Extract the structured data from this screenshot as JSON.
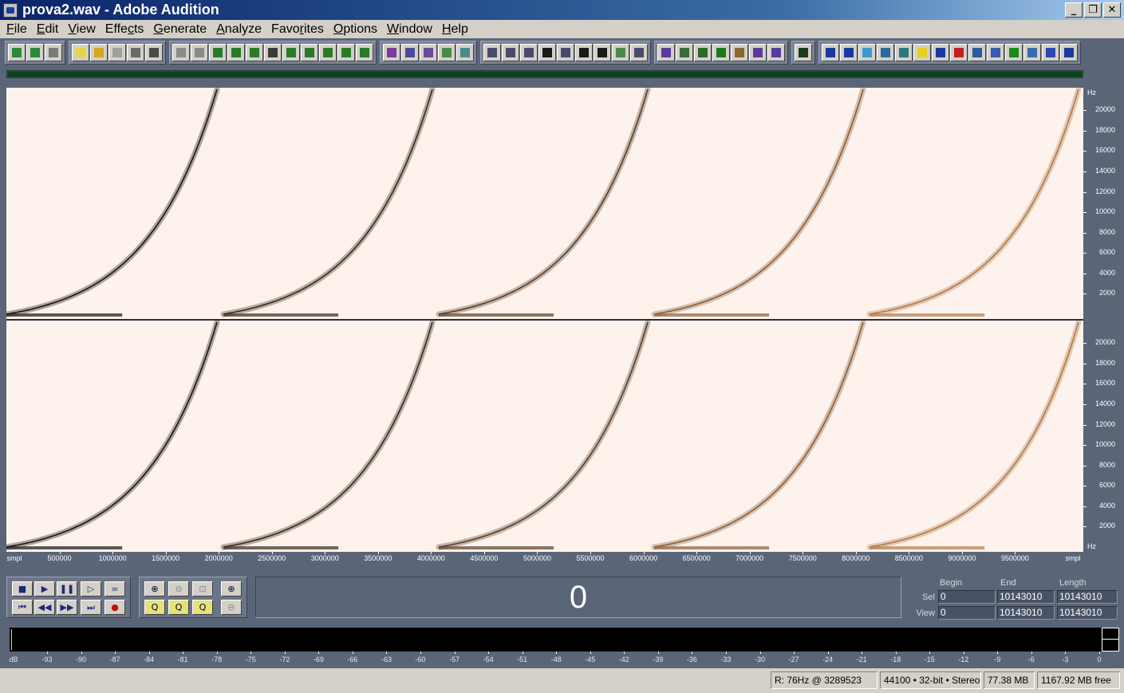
{
  "window": {
    "title": "prova2.wav - Adobe Audition",
    "icon": "audition-app-icon",
    "minimize_glyph": "_",
    "restore_glyph": "❐",
    "close_glyph": "✕"
  },
  "menu": [
    {
      "label": "File",
      "ul": "F",
      "rest": "ile"
    },
    {
      "label": "Edit",
      "ul": "E",
      "rest": "dit"
    },
    {
      "label": "View",
      "ul": "V",
      "rest": "iew"
    },
    {
      "label": "Effects",
      "pre": "Effe",
      "ul": "c",
      "rest": "ts"
    },
    {
      "label": "Generate",
      "ul": "G",
      "rest": "enerate"
    },
    {
      "label": "Analyze",
      "ul": "A",
      "rest": "nalyze"
    },
    {
      "label": "Favorites",
      "pre": "Favo",
      "ul": "r",
      "rest": "ites"
    },
    {
      "label": "Options",
      "ul": "O",
      "rest": "ptions"
    },
    {
      "label": "Window",
      "ul": "W",
      "rest": "indow"
    },
    {
      "label": "Help",
      "ul": "H",
      "rest": "elp"
    }
  ],
  "toolbar_groups": [
    {
      "icons": [
        "multitrack-view-icon",
        "edit-view-icon",
        "cd-view-icon"
      ],
      "colors": [
        "#2a8a3a",
        "#2a8a3a",
        "#7a7a7a"
      ]
    },
    {
      "icons": [
        "new-file-icon",
        "open-file-icon",
        "save-icon",
        "save-as-icon",
        "save-all-icon"
      ],
      "colors": [
        "#e6d44a",
        "#d4a820",
        "#a0a0a0",
        "#6a6a6a",
        "#4a4a4a"
      ]
    },
    {
      "icons": [
        "undo-icon",
        "redo-icon",
        "repeat-icon",
        "copy-to-new-icon",
        "copy-icon",
        "cut-icon",
        "paste-icon",
        "paste-new-icon",
        "mix-paste-icon",
        "trim-icon",
        "crop-icon"
      ],
      "colors": [
        "#8a8a8a",
        "#8a8a8a",
        "#2a7a2a",
        "#2a7a2a",
        "#2a7a2a",
        "#3a3a3a",
        "#2a7a2a",
        "#2a7a2a",
        "#2a7a2a",
        "#2a7a2a",
        "#2a7a2a"
      ]
    },
    {
      "icons": [
        "envelope-icon",
        "check-icon",
        "grid-purple-icon",
        "grid-green-icon",
        "grid-multi-icon"
      ],
      "colors": [
        "#7a3aa0",
        "#4a4aa0",
        "#6a4a9a",
        "#4a8a4a",
        "#4a8a8a"
      ]
    },
    {
      "icons": [
        "window-icon",
        "window2-icon",
        "window3-icon",
        "play-arrow-icon",
        "zoom-small-icon",
        "time-015-icon",
        "bbb-icon",
        "bars-icon",
        "list-icon"
      ],
      "colors": [
        "#4a4a6a",
        "#4a4a6a",
        "#4a4a6a",
        "#1a1a1a",
        "#4a4a6a",
        "#1a1a1a",
        "#1a1a1a",
        "#4a8a4a",
        "#4a4a6a"
      ]
    },
    {
      "icons": [
        "pencil-purple-icon",
        "noise-icon",
        "noise2-icon",
        "wave-green-icon",
        "brush-icon",
        "pencil-icon",
        "pencil2-icon"
      ],
      "colors": [
        "#5a3aa0",
        "#3a6a3a",
        "#2a6a2a",
        "#1a7a1a",
        "#8a6a2a",
        "#5a3aa0",
        "#5a3aa0"
      ]
    },
    {
      "icons": [
        "spectrum-meter-icon"
      ],
      "colors": [
        "#1a3a1a"
      ]
    },
    {
      "icons": [
        "ap-icon",
        "ap42-icon",
        "mg-icon",
        "vrd-icon",
        "close-x-icon",
        "yellow-icon",
        "tb-icon",
        "red-green-icon",
        "bars-blue-icon",
        "stripes-icon",
        "tree-icon",
        "itu-p56-icon",
        "sti-icon",
        "flag-icon"
      ],
      "colors": [
        "#1a3aa0",
        "#1a3aa0",
        "#3a9aca",
        "#2a6aa0",
        "#2a7a7a",
        "#e6d020",
        "#1a3aa0",
        "#c02020",
        "#2a5aa0",
        "#3a5ab0",
        "#1a8a1a",
        "#3a6ab0",
        "#2a4ab0",
        "#1a3aa0"
      ]
    }
  ],
  "spectral": {
    "channels": [
      "left",
      "right"
    ],
    "bg_color": "#fdf2ec",
    "sweep_count": 5,
    "sweep_colors": [
      "#1a1512",
      "#3a2a1e",
      "#5a3e2a",
      "#8a5e3a",
      "#b07a4a"
    ]
  },
  "hz_ruler": {
    "unit": "Hz",
    "labels": [
      "20000",
      "18000",
      "16000",
      "14000",
      "12000",
      "10000",
      "8000",
      "6000",
      "4000",
      "2000"
    ]
  },
  "time_ruler": {
    "unit": "smpl",
    "labels": [
      "500000",
      "1000000",
      "1500000",
      "2000000",
      "2500000",
      "3000000",
      "3500000",
      "4000000",
      "4500000",
      "5000000",
      "5500000",
      "6000000",
      "6500000",
      "7000000",
      "7500000",
      "8000000",
      "8500000",
      "9000000",
      "9500000"
    ]
  },
  "transport": {
    "stop": "■",
    "play": "▶",
    "pause": "❚❚",
    "play_to_end": "▷",
    "loop": "∞",
    "go_start": "⏮",
    "rewind": "◀◀",
    "forward": "▶▶",
    "go_end": "⏭",
    "record": "●"
  },
  "zoom": {
    "zoom_in_h": "⊕",
    "zoom_out_h": "⊖",
    "zoom_full": "⊡",
    "zoom_in_v": "⊕",
    "zoom_left": "Q",
    "zoom_right": "Q",
    "zoom_sel": "Q",
    "zoom_out_v": "⊖"
  },
  "time_display": {
    "value": "0"
  },
  "selection": {
    "headers": {
      "begin": "Begin",
      "end": "End",
      "length": "Length"
    },
    "sel": {
      "label": "Sel",
      "begin": "0",
      "end": "10143010",
      "length": "10143010"
    },
    "view": {
      "label": "View",
      "begin": "0",
      "end": "10143010",
      "length": "10143010"
    }
  },
  "level_meter": {
    "unit": "dB",
    "labels": [
      "-93",
      "-90",
      "-87",
      "-84",
      "-81",
      "-78",
      "-75",
      "-72",
      "-69",
      "-66",
      "-63",
      "-60",
      "-57",
      "-54",
      "-51",
      "-48",
      "-45",
      "-42",
      "-39",
      "-36",
      "-33",
      "-30",
      "-27",
      "-24",
      "-21",
      "-18",
      "-15",
      "-12",
      "-9",
      "-6",
      "-3",
      "0"
    ]
  },
  "status": {
    "cursor": "R: 76Hz @ 3289523",
    "format": "44100 • 32-bit • Stereo",
    "size": "77.38 MB",
    "free": "1167.92 MB free"
  }
}
